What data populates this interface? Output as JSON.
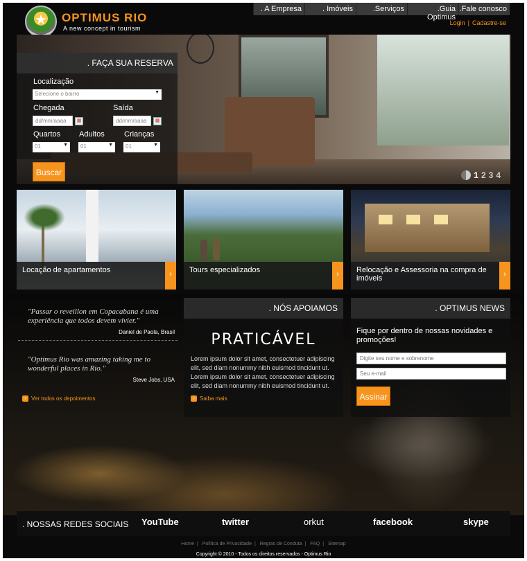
{
  "brand": {
    "name": "OPTIMUS RIO",
    "tagline": "A new concept in tourism"
  },
  "nav": [
    ". A Empresa",
    ". Imóveis",
    ".Serviços",
    ".Guia Optimus",
    ".Fale conosco"
  ],
  "account": {
    "login": "Login",
    "signup": "Cadastre-se"
  },
  "reserva": {
    "title": ". FAÇA SUA RESERVA",
    "localizacao_label": "Localização",
    "bairro_value": "Selecione o bairro",
    "chegada_label": "Chegada",
    "saida_label": "Saída",
    "date_placeholder": "dd/mm/aaaa",
    "quartos_label": "Quartos",
    "adultos_label": "Adultos",
    "criancas_label": "Crianças",
    "select_value": "01",
    "button": "Buscar"
  },
  "slider": {
    "pages": [
      "1",
      "2",
      "3",
      "4"
    ],
    "current": "1"
  },
  "tiles": [
    {
      "caption": "Locação de apartamentos"
    },
    {
      "caption": "Tours especializados"
    },
    {
      "caption": "Relocação e Assessoria na compra de imóveis"
    }
  ],
  "testimonials": [
    {
      "quote": "\"Passar o reveillon em Copacabana é uma experiência que todos devem vivier.\"",
      "author": "Daniel de Paola, Brasil"
    },
    {
      "quote": "\"Optimus Rio was amazing taking me to wonderful places in Rio.\"",
      "author": "Steve Jobs, USA"
    }
  ],
  "testimonials_link": "Ver todos os depoimentos",
  "apoiamos": {
    "title": ". NÓS APOIAMOS",
    "logo": "PRATICÁVEL",
    "body": "Lorem ipsum dolor sit amet, consectetuer adipiscing elit, sed diam nonummy nibh euismod tincidunt ut. Lorem ipsum dolor sit amet, consectetuer adipiscing elit, sed diam nonummy nibh euismod tincidunt ut.",
    "link": "Saiba mais"
  },
  "news": {
    "title": ". OPTIMUS NEWS",
    "intro": "Fique por dentro de nossas novidades e promoções!",
    "name_placeholder": "Digite seu nome e sobrenome",
    "email_placeholder": "Seu e-mail",
    "button": "Assinar"
  },
  "social": {
    "title": ". NOSSAS REDES SOCIAIS",
    "networks": [
      "YouTube",
      "twitter",
      "orkut",
      "facebook",
      "skype"
    ]
  },
  "footer": {
    "links": [
      "Home",
      "Política de Privacidade",
      "Regras de Conduta",
      "FAQ",
      "Sitemap"
    ],
    "copyright": "Copyright © 2010 - Todos os direitos reservados - Optimus Rio"
  },
  "colors": {
    "accent": "#f7941d",
    "background": "#0a0a0a",
    "panel": "#2a2a2a"
  }
}
